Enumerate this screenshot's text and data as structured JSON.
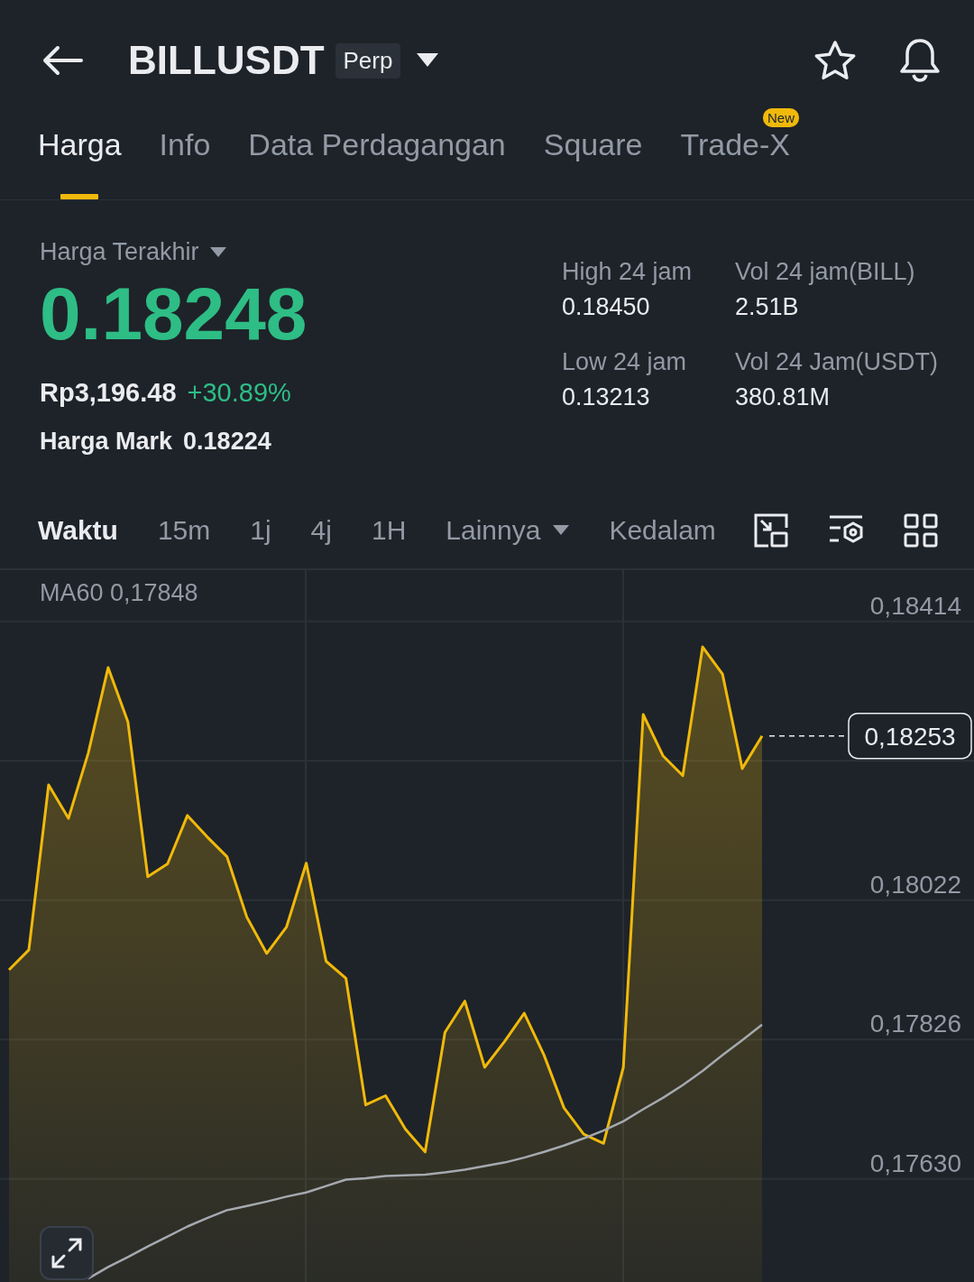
{
  "header": {
    "symbol": "BILLUSDT",
    "badge": "Perp"
  },
  "tabs": [
    {
      "label": "Harga",
      "selected": true
    },
    {
      "label": "Info",
      "selected": false
    },
    {
      "label": "Data Perdagangan",
      "selected": false
    },
    {
      "label": "Square",
      "selected": false
    },
    {
      "label": "Trade-X",
      "selected": false,
      "badge": "New"
    }
  ],
  "price": {
    "selector": "Harga Terakhir",
    "last": "0.18248",
    "fiat": "Rp3,196.48",
    "change": "+30.89%",
    "mark_label": "Harga Mark",
    "mark": "0.18224"
  },
  "stats": [
    {
      "label": "High 24 jam",
      "value": "0.18450"
    },
    {
      "label": "Vol 24 jam(BILL)",
      "value": "2.51B"
    },
    {
      "label": "Low 24 jam",
      "value": "0.13213"
    },
    {
      "label": "Vol 24 Jam(USDT)",
      "value": "380.81M"
    }
  ],
  "intervals": [
    {
      "label": "Waktu",
      "selected": true
    },
    {
      "label": "15m",
      "selected": false
    },
    {
      "label": "1j",
      "selected": false
    },
    {
      "label": "4j",
      "selected": false
    },
    {
      "label": "1H",
      "selected": false
    },
    {
      "label": "Lainnya",
      "selected": false,
      "dropdown": true
    },
    {
      "label": "Kedalam",
      "selected": false
    }
  ],
  "chart": {
    "ma_value": "0,17848",
    "current_price": "0,18253",
    "chart_data": {
      "type": "line",
      "grid": true,
      "ylim": [
        0.17485,
        0.18486
      ],
      "yticks": [
        {
          "value": 0.18414,
          "label": "0,18414"
        },
        {
          "value": 0.18022,
          "label": "0,18022"
        },
        {
          "value": 0.17826,
          "label": "0,17826"
        },
        {
          "value": 0.1763,
          "label": "0,17630"
        }
      ],
      "series": [
        {
          "type": "area",
          "color": "#f0b90b",
          "values": [
            0.17924,
            0.17952,
            0.18184,
            0.18137,
            0.18229,
            0.18349,
            0.18273,
            0.18055,
            0.18073,
            0.18141,
            0.18111,
            0.18083,
            0.17998,
            0.17947,
            0.17984,
            0.18074,
            0.17936,
            0.17912,
            0.17734,
            0.17747,
            0.177,
            0.17668,
            0.17836,
            0.1788,
            0.17787,
            0.17823,
            0.17863,
            0.17804,
            0.1773,
            0.17693,
            0.1768,
            0.17787,
            0.18283,
            0.18225,
            0.18197,
            0.18378,
            0.1834,
            0.18207,
            0.18253
          ]
        },
        {
          "name": "MA60",
          "type": "line",
          "color": "#a5a9b0",
          "values": [
            null,
            null,
            null,
            null,
            0.1749,
            0.17506,
            0.1752,
            0.17535,
            0.17549,
            0.17563,
            0.17575,
            0.17586,
            0.17592,
            0.17598,
            0.17605,
            0.17611,
            0.1762,
            0.17629,
            0.17631,
            0.17634,
            0.17635,
            0.17636,
            0.17639,
            0.17643,
            0.17648,
            0.17653,
            0.1766,
            0.17668,
            0.17677,
            0.17687,
            0.17698,
            0.17711,
            0.17728,
            0.17744,
            0.17762,
            0.17782,
            0.17804,
            0.17825,
            0.17847
          ]
        }
      ]
    }
  }
}
